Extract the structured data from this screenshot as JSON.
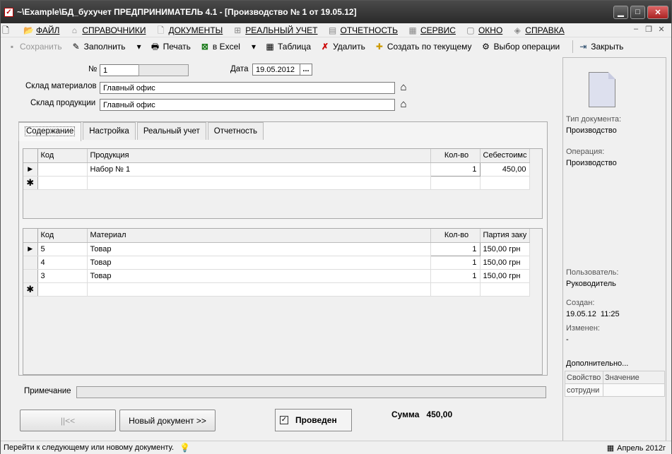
{
  "window": {
    "title": "~\\Example\\БД_бухучет ПРЕДПРИНИМАТЕЛЬ 4.1 - [Производство № 1 от 19.05.12]"
  },
  "menu": [
    "ФАЙЛ",
    "СПРАВОЧНИКИ",
    "ДОКУМЕНТЫ",
    "РЕАЛЬНЫЙ УЧЕТ",
    "ОТЧЕТНОСТЬ",
    "СЕРВИС",
    "ОКНО",
    "СПРАВКА"
  ],
  "toolbar": {
    "save": "Сохранить",
    "fill": "Заполнить",
    "print": "Печать",
    "excel": "в Excel",
    "table": "Таблица",
    "delete": "Удалить",
    "create": "Создать по текущему",
    "op_select": "Выбор операции",
    "close": "Закрыть"
  },
  "form": {
    "number_label": "№",
    "number": "1",
    "date_label": "Дата",
    "date": "19.05.2012",
    "date_btn": "...",
    "mat_wh_label": "Склад материалов",
    "mat_wh": "Главный офис",
    "prod_wh_label": "Склад продукции",
    "prod_wh": "Главный офис"
  },
  "tabs": [
    "Содержание",
    "Настройка",
    "Реальный учет",
    "Отчетность"
  ],
  "products": {
    "headers": [
      "Код",
      "Продукция",
      "Кол-во",
      "Себестоимс"
    ],
    "rows": [
      {
        "code": "",
        "name": "Набор № 1",
        "qty": "1",
        "cost": "450,00"
      }
    ]
  },
  "materials": {
    "headers": [
      "Код",
      "Материал",
      "Кол-во",
      "Партия заку"
    ],
    "rows": [
      {
        "code": "5",
        "name": "Товар",
        "qty": "1",
        "batch": "150,00 грн"
      },
      {
        "code": "4",
        "name": "Товар",
        "qty": "1",
        "batch": "150,00 грн"
      },
      {
        "code": "3",
        "name": "Товар",
        "qty": "1",
        "batch": "150,00 грн"
      }
    ]
  },
  "note_label": "Примечание",
  "buttons": {
    "first": "||<<",
    "new_doc": "Новый документ >>"
  },
  "posted": "Проведен",
  "sum": "Сумма   450,00",
  "side": {
    "doc_type_label": "Тип документа:",
    "doc_type": "Производство",
    "operation_label": "Операция:",
    "operation": "Производство",
    "user_label": "Пользователь:",
    "user": "Руководитель",
    "created_label": "Создан:",
    "created": "19.05.12  11:25",
    "changed_label": "Изменен:",
    "changed": "-",
    "extra_label": "Дополнительно...",
    "prop_headers": [
      "Свойство",
      "Значение"
    ],
    "prop_row": "сотрудни"
  },
  "status": {
    "text": "Перейти к следующему или новому документу.",
    "date": "Апрель 2012г"
  }
}
